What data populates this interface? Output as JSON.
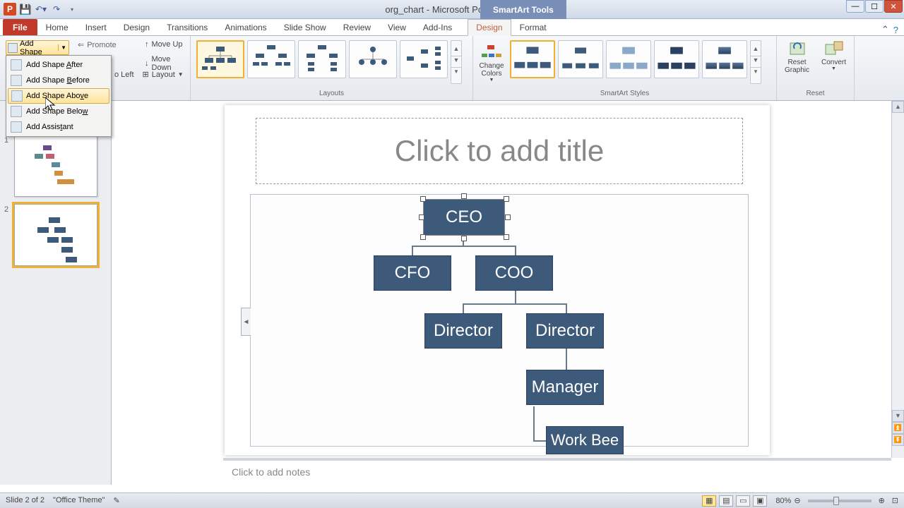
{
  "app": {
    "title": "org_chart - Microsoft PowerPoint",
    "tools_tab": "SmartArt Tools"
  },
  "tabs": {
    "file": "File",
    "home": "Home",
    "insert": "Insert",
    "design_main": "Design",
    "transitions": "Transitions",
    "animations": "Animations",
    "slideshow": "Slide Show",
    "review": "Review",
    "view": "View",
    "addins": "Add-Ins",
    "sa_design": "Design",
    "sa_format": "Format"
  },
  "ribbon": {
    "add_shape": "Add Shape",
    "promote": "Promote",
    "move_up": "Move Up",
    "move_down": "Move Down",
    "to_left": "o Left",
    "layout": "Layout",
    "layouts_label": "Layouts",
    "change_colors": "Change Colors",
    "styles_label": "SmartArt Styles",
    "reset_graphic": "Reset Graphic",
    "convert": "Convert",
    "reset_label": "Reset"
  },
  "addshape_menu": {
    "after": "Add Shape After",
    "before": "Add Shape Before",
    "above": "Add Shape Above",
    "below": "Add Shape Below",
    "assistant": "Add Assistant"
  },
  "slide": {
    "title_placeholder": "Click to add title",
    "notes_placeholder": "Click to add notes",
    "nodes": {
      "ceo": "CEO",
      "cfo": "CFO",
      "coo": "COO",
      "director1": "Director",
      "director2": "Director",
      "manager": "Manager",
      "workbee": "Work Bee"
    }
  },
  "slides_panel": {
    "n1": "1",
    "n2": "2"
  },
  "status": {
    "slide_info": "Slide 2 of 2",
    "theme": "\"Office Theme\"",
    "zoom": "80%"
  },
  "colors": {
    "node_fill": "#3e5a7a",
    "accent": "#f0b030"
  }
}
